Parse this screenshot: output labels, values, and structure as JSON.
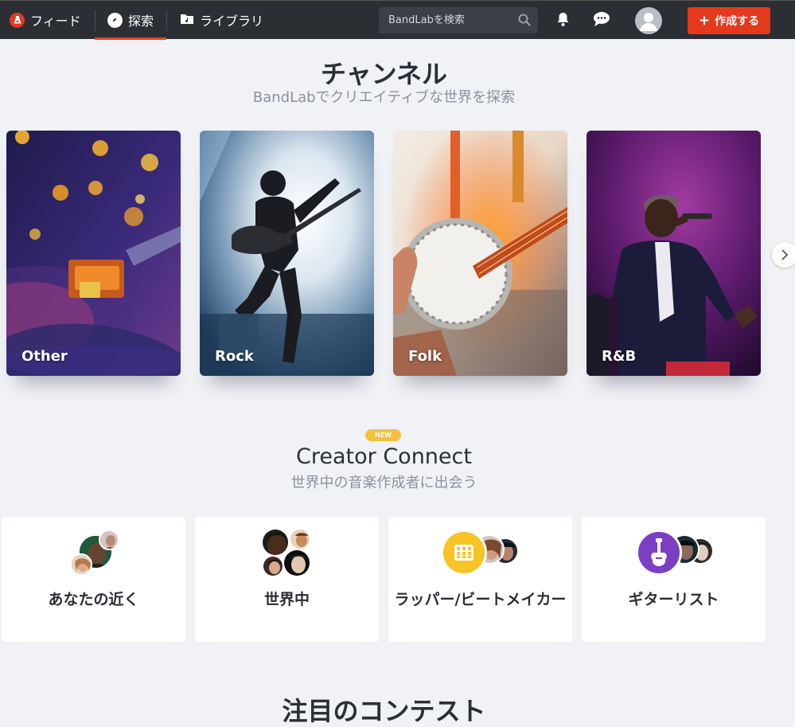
{
  "nav": {
    "feed_label": "フィード",
    "explore_label": "探索",
    "library_label": "ライブラリ",
    "search_placeholder": "BandLabを検索",
    "create_label": "作成する",
    "accent_color": "#e3391d"
  },
  "channels": {
    "title": "チャンネル",
    "subtitle": "BandLabでクリエイティブな世界を探索",
    "cards": [
      {
        "label": "Other"
      },
      {
        "label": "Rock"
      },
      {
        "label": "Folk"
      },
      {
        "label": "R&B"
      }
    ]
  },
  "creator_connect": {
    "badge": "NEW",
    "title": "Creator Connect",
    "subtitle": "世界中の音楽作成者に出会う",
    "cards": [
      {
        "label": "あなたの近く"
      },
      {
        "label": "世界中"
      },
      {
        "label": "ラッパー/ビートメイカー"
      },
      {
        "label": "ギターリスト"
      }
    ]
  },
  "contests": {
    "title": "注目のコンテスト"
  }
}
